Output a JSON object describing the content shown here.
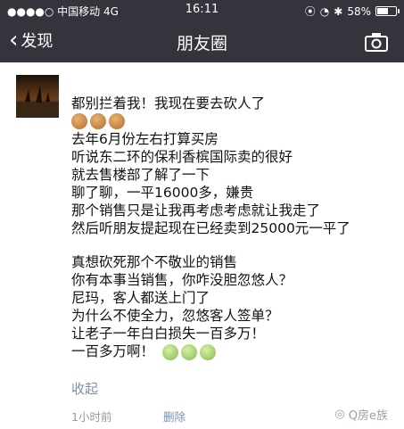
{
  "status_bar": {
    "carrier": "●●●●○ 中国移动",
    "network": "4G",
    "time": "16:11",
    "battery": "58%",
    "battery_level": 0.58
  },
  "nav": {
    "back_label": "发现",
    "title": "朋友圈"
  },
  "post": {
    "username": "",
    "lines": [
      "都别拦着我！我现在要去砍人了",
      "去年6月份左右打算买房",
      "听说东二环的保利香槟国际卖的很好",
      "就去售楼部了解了一下",
      "聊了聊，一平16000多，嫌贵",
      "那个销售只是让我再考虑考虑就让我走了",
      "然后听朋友提起现在已经卖到25000元一平了",
      "真想砍死那个不敬业的销售",
      "你有本事当销售，你咋没胆忽悠人？",
      "尼玛，客人都送上门了",
      "为什么不使全力，忽悠客人签单？",
      "让老子一年白白损失一百多万！",
      "一百多万啊！"
    ],
    "collapse_label": "收起",
    "time_ago": "1小时前",
    "delete_label": "删除",
    "watermark": "Q房e族"
  },
  "colors": {
    "bar_bg": "#34343c",
    "link": "#7a8fb3",
    "muted": "#999999"
  }
}
